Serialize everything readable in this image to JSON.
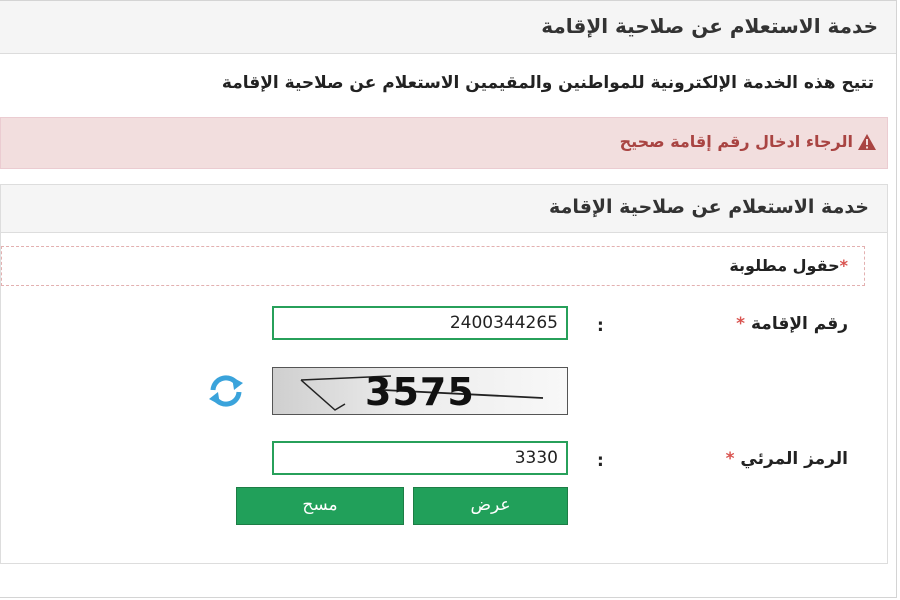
{
  "page": {
    "title": "خدمة الاستعلام عن صلاحية الإقامة",
    "description": "تتيح هذه الخدمة الإلكترونية للمواطنين والمقيمين الاستعلام عن صلاحية الإقامة"
  },
  "alert": {
    "message": "الرجاء ادخال رقم إقامة صحيح",
    "icon": "warning-icon",
    "color": "#a94442"
  },
  "panel": {
    "title": "خدمة الاستعلام عن صلاحية الإقامة",
    "required_note": "حقول مطلوبة",
    "required_star": "*"
  },
  "form": {
    "iqama_label": "رقم الإقامة",
    "iqama_value": "2400344265",
    "captcha_label": "الرمز المرئي",
    "captcha_value": "3330",
    "captcha_image_text": "3575",
    "colon": ":",
    "star": "*"
  },
  "buttons": {
    "submit": "عرض",
    "clear": "مسح"
  },
  "colors": {
    "accent_green": "#21a05a",
    "alert_bg": "#f2dede",
    "required_star": "#d9534f",
    "refresh_icon": "#3aa3db"
  }
}
